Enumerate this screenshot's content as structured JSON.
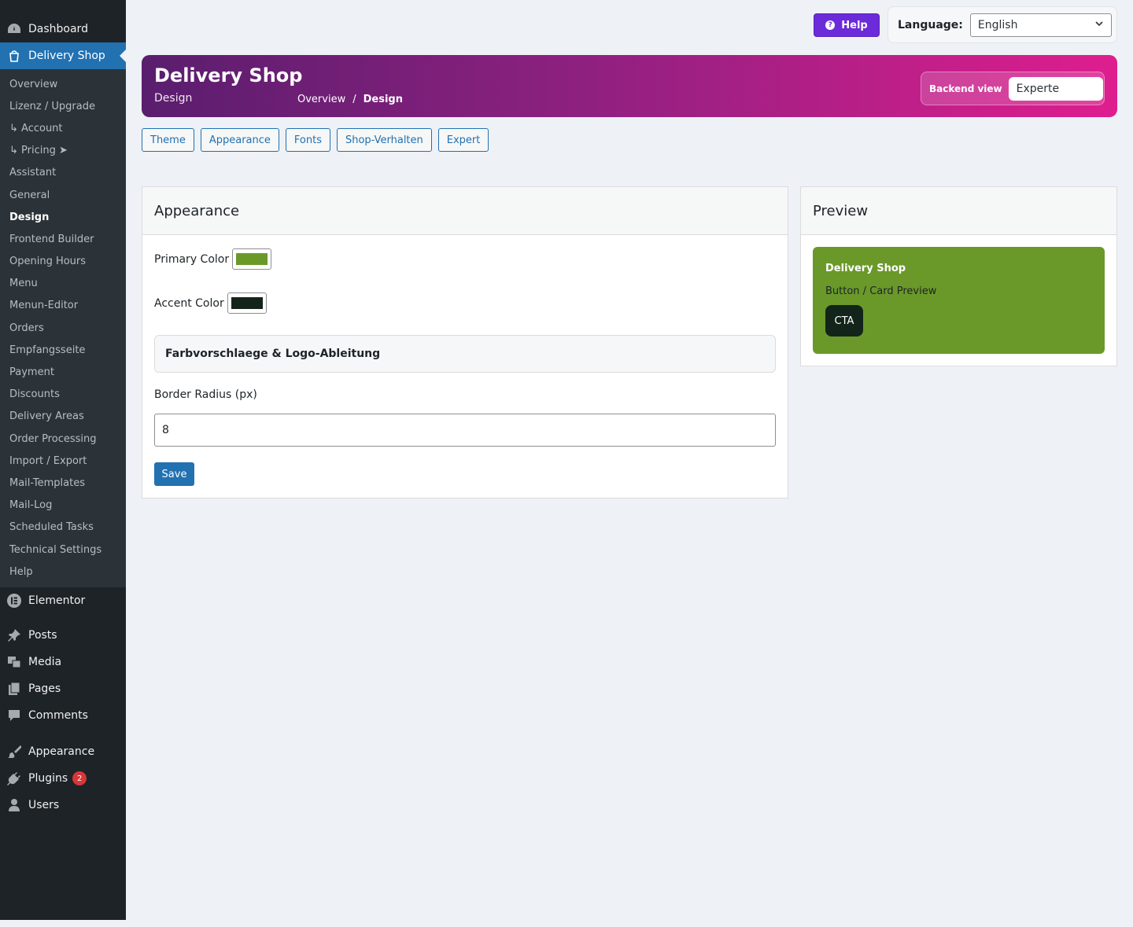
{
  "colors": {
    "sidebar_bg": "#1d2327",
    "accent_blue": "#2271b1",
    "help_purple": "#6c2bd9",
    "primary_color": "#6a992a",
    "accent_color": "#13251a"
  },
  "sidebar": {
    "top_items": [
      {
        "label": "Dashboard",
        "icon": "dashboard-icon"
      },
      {
        "label": "Delivery Shop",
        "icon": "shopping-bag-icon"
      }
    ],
    "submenu": [
      "Overview",
      "Lizenz / Upgrade",
      "↳ Account",
      "↳ Pricing ➤",
      "Assistant",
      "General",
      "Design",
      "Frontend Builder",
      "Opening Hours",
      "Menu",
      "Menun-Editor",
      "Orders",
      "Empfangsseite",
      "Payment",
      "Discounts",
      "Delivery Areas",
      "Order Processing",
      "Import / Export",
      "Mail-Templates",
      "Mail-Log",
      "Scheduled Tasks",
      "Technical Settings",
      "Help"
    ],
    "elementor": "Elementor",
    "content_items": [
      "Posts",
      "Media",
      "Pages",
      "Comments"
    ],
    "appearance": "Appearance",
    "plugins": "Plugins",
    "plugins_badge": "2",
    "users": "Users"
  },
  "topbar": {
    "help_label": "Help",
    "language_label": "Language:",
    "language_value": "English"
  },
  "header": {
    "title": "Delivery Shop",
    "subtitle": "Design",
    "breadcrumb_overview": "Overview",
    "breadcrumb_sep": "/",
    "breadcrumb_current": "Design",
    "backend_label": "Backend view",
    "backend_value": "Experte"
  },
  "tabs": [
    "Theme",
    "Appearance",
    "Fonts",
    "Shop-Verhalten",
    "Expert"
  ],
  "appearance_panel": {
    "title": "Appearance",
    "primary_label": "Primary Color",
    "accent_label": "Accent Color",
    "collapse_label": "Farbvorschlaege & Logo-Ableitung",
    "border_radius_label": "Border Radius (px)",
    "border_radius_value": "8",
    "save_label": "Save"
  },
  "preview_panel": {
    "title": "Preview",
    "card_title": "Delivery Shop",
    "card_subtitle": "Button / Card Preview",
    "cta_label": "CTA"
  }
}
